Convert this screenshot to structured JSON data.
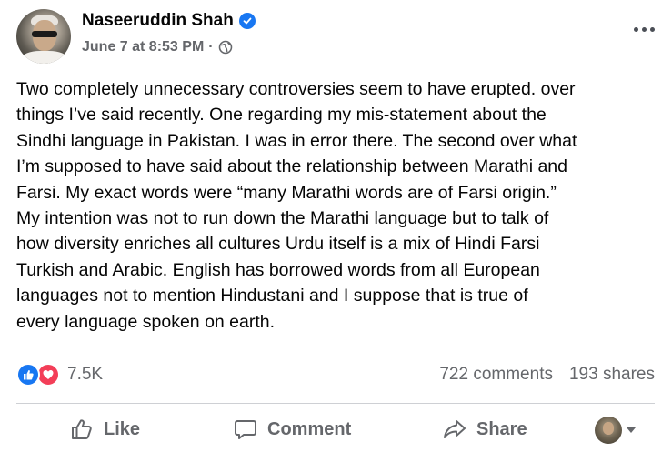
{
  "post": {
    "author": "Naseeruddin Shah",
    "timestamp": "June 7 at 8:53 PM",
    "separator": "·",
    "audience_icon": "globe-icon",
    "verified_icon": "verified-badge-icon",
    "text": "Two completely unnecessary controversies seem to have erupted. over\nthings I’ve said recently. One regarding my mis-statement about the\nSindhi language in Pakistan. I was in error there. The second over what\nI’m supposed to have said about the relationship between Marathi and\nFarsi. My exact words were “many  Marathi words are of Farsi origin.”\nMy intention was not to run down the Marathi language but to talk of\nhow diversity enriches all cultures  Urdu itself is a mix of Hindi Farsi\nTurkish and Arabic. English has borrowed words from all European\nlanguages not to mention Hindustani and I suppose that is true of\nevery language spoken on earth."
  },
  "stats": {
    "reaction_icons": [
      "like-icon",
      "love-icon"
    ],
    "reaction_count": "7.5K",
    "comments": "722 comments",
    "shares": "193 shares"
  },
  "actions": {
    "like": "Like",
    "comment": "Comment",
    "share": "Share"
  },
  "colors": {
    "primary_text": "#050505",
    "secondary_text": "#65676b",
    "like_blue": "#1877f2",
    "love_red": "#f33e58",
    "divider": "#ced0d4"
  }
}
